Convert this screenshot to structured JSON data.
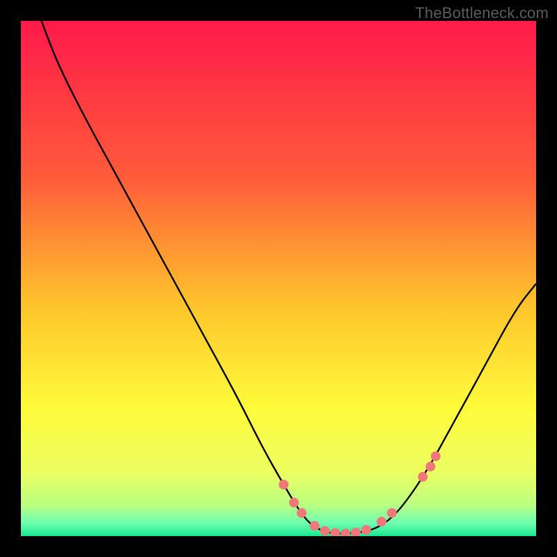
{
  "watermark": "TheBottleneck.com",
  "chart_data": {
    "type": "line",
    "title": "",
    "xlabel": "",
    "ylabel": "",
    "xlim": [
      0,
      100
    ],
    "ylim": [
      0,
      100
    ],
    "background_gradient_stops": [
      {
        "offset": 0.0,
        "color": "#ff1a4b"
      },
      {
        "offset": 0.3,
        "color": "#ff5a3a"
      },
      {
        "offset": 0.55,
        "color": "#ffc32c"
      },
      {
        "offset": 0.75,
        "color": "#fffb3a"
      },
      {
        "offset": 0.88,
        "color": "#eaff62"
      },
      {
        "offset": 0.94,
        "color": "#b8ff82"
      },
      {
        "offset": 0.975,
        "color": "#6fffb0"
      },
      {
        "offset": 1.0,
        "color": "#17e892"
      }
    ],
    "series": [
      {
        "name": "bottleneck-curve",
        "x": [
          4,
          7,
          12,
          18,
          24,
          30,
          36,
          42,
          47,
          51,
          54,
          56,
          58,
          60,
          63,
          66,
          69,
          72,
          75,
          79,
          84,
          90,
          96,
          100
        ],
        "y": [
          100,
          92,
          82,
          71,
          60,
          49,
          38,
          27,
          17,
          10,
          5,
          2.5,
          1.2,
          0.6,
          0.5,
          0.7,
          1.5,
          3.5,
          7,
          13,
          22,
          33,
          44,
          49
        ]
      }
    ],
    "markers": {
      "name": "highlight-points",
      "color": "#f07878",
      "radius_px": 7,
      "x": [
        51,
        53,
        54.5,
        57,
        59,
        61,
        63,
        65,
        67,
        70,
        72,
        78,
        79.5,
        80.5
      ],
      "y": [
        10,
        6.5,
        4.5,
        2,
        1,
        0.6,
        0.5,
        0.7,
        1.2,
        2.8,
        4.5,
        11.5,
        13.5,
        15.5
      ]
    }
  }
}
